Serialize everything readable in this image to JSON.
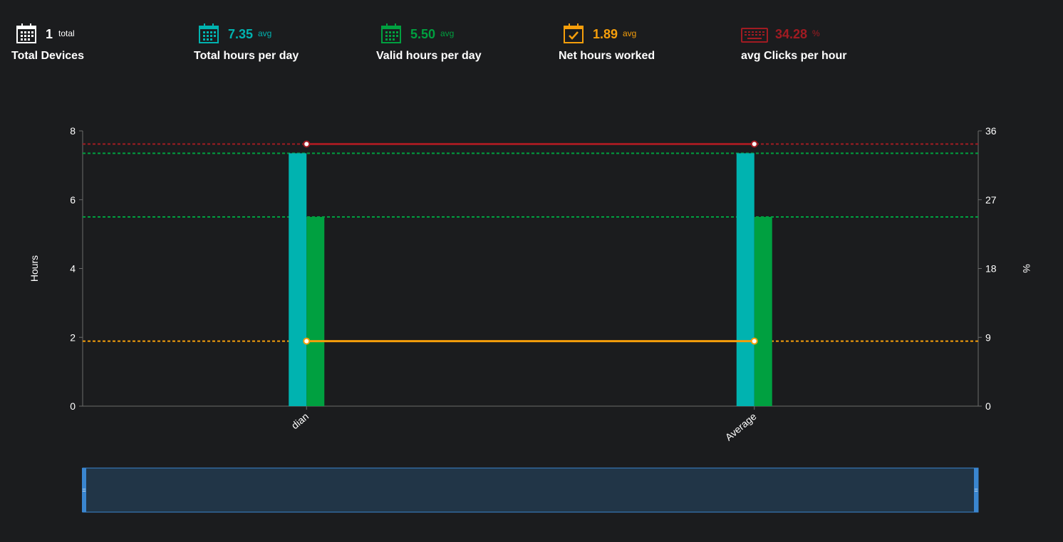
{
  "stats": [
    {
      "value": "1",
      "unit": "total",
      "label": "Total Devices",
      "color": "#ffffff",
      "icon": "calendar-grid-icon"
    },
    {
      "value": "7.35",
      "unit": "avg",
      "label": "Total hours per day",
      "color": "#00b3b0",
      "icon": "calendar-grid-icon"
    },
    {
      "value": "5.50",
      "unit": "avg",
      "label": "Valid hours per day",
      "color": "#00a040",
      "icon": "calendar-grid-icon"
    },
    {
      "value": "1.89",
      "unit": "avg",
      "label": "Net hours worked",
      "color": "#f59e0b",
      "icon": "calendar-check-icon"
    },
    {
      "value": "34.28",
      "unit": "%",
      "label": "avg Clicks per hour",
      "color": "#a11b22",
      "icon": "keyboard-icon"
    }
  ],
  "chart_data": {
    "type": "bar",
    "categories": [
      "dian",
      "Average"
    ],
    "series": [
      {
        "values": [
          7.35,
          7.35
        ],
        "color": "#00b3b0",
        "kind": "bar",
        "axis": "left"
      },
      {
        "values": [
          5.5,
          5.5
        ],
        "color": "#00a040",
        "kind": "bar",
        "axis": "left"
      },
      {
        "values": [
          1.89,
          1.89
        ],
        "color": "#f59e0b",
        "kind": "line",
        "axis": "left"
      },
      {
        "values": [
          34.28,
          34.28
        ],
        "color": "#a11b22",
        "kind": "line",
        "axis": "right"
      }
    ],
    "reference_lines": [
      {
        "value": 7.35,
        "axis": "left",
        "color": "#00a040"
      },
      {
        "value": 5.5,
        "axis": "left",
        "color": "#00a040"
      },
      {
        "value": 1.89,
        "axis": "left",
        "color": "#f59e0b"
      },
      {
        "value": 34.28,
        "axis": "right",
        "color": "#a11b22"
      }
    ],
    "ylabel": "Hours",
    "y2label": "%",
    "ylim": [
      0,
      8
    ],
    "yticks": [
      0,
      2,
      4,
      6,
      8
    ],
    "y2lim": [
      0,
      36
    ],
    "y2ticks": [
      0,
      9,
      18,
      27,
      36
    ],
    "grid": false
  }
}
